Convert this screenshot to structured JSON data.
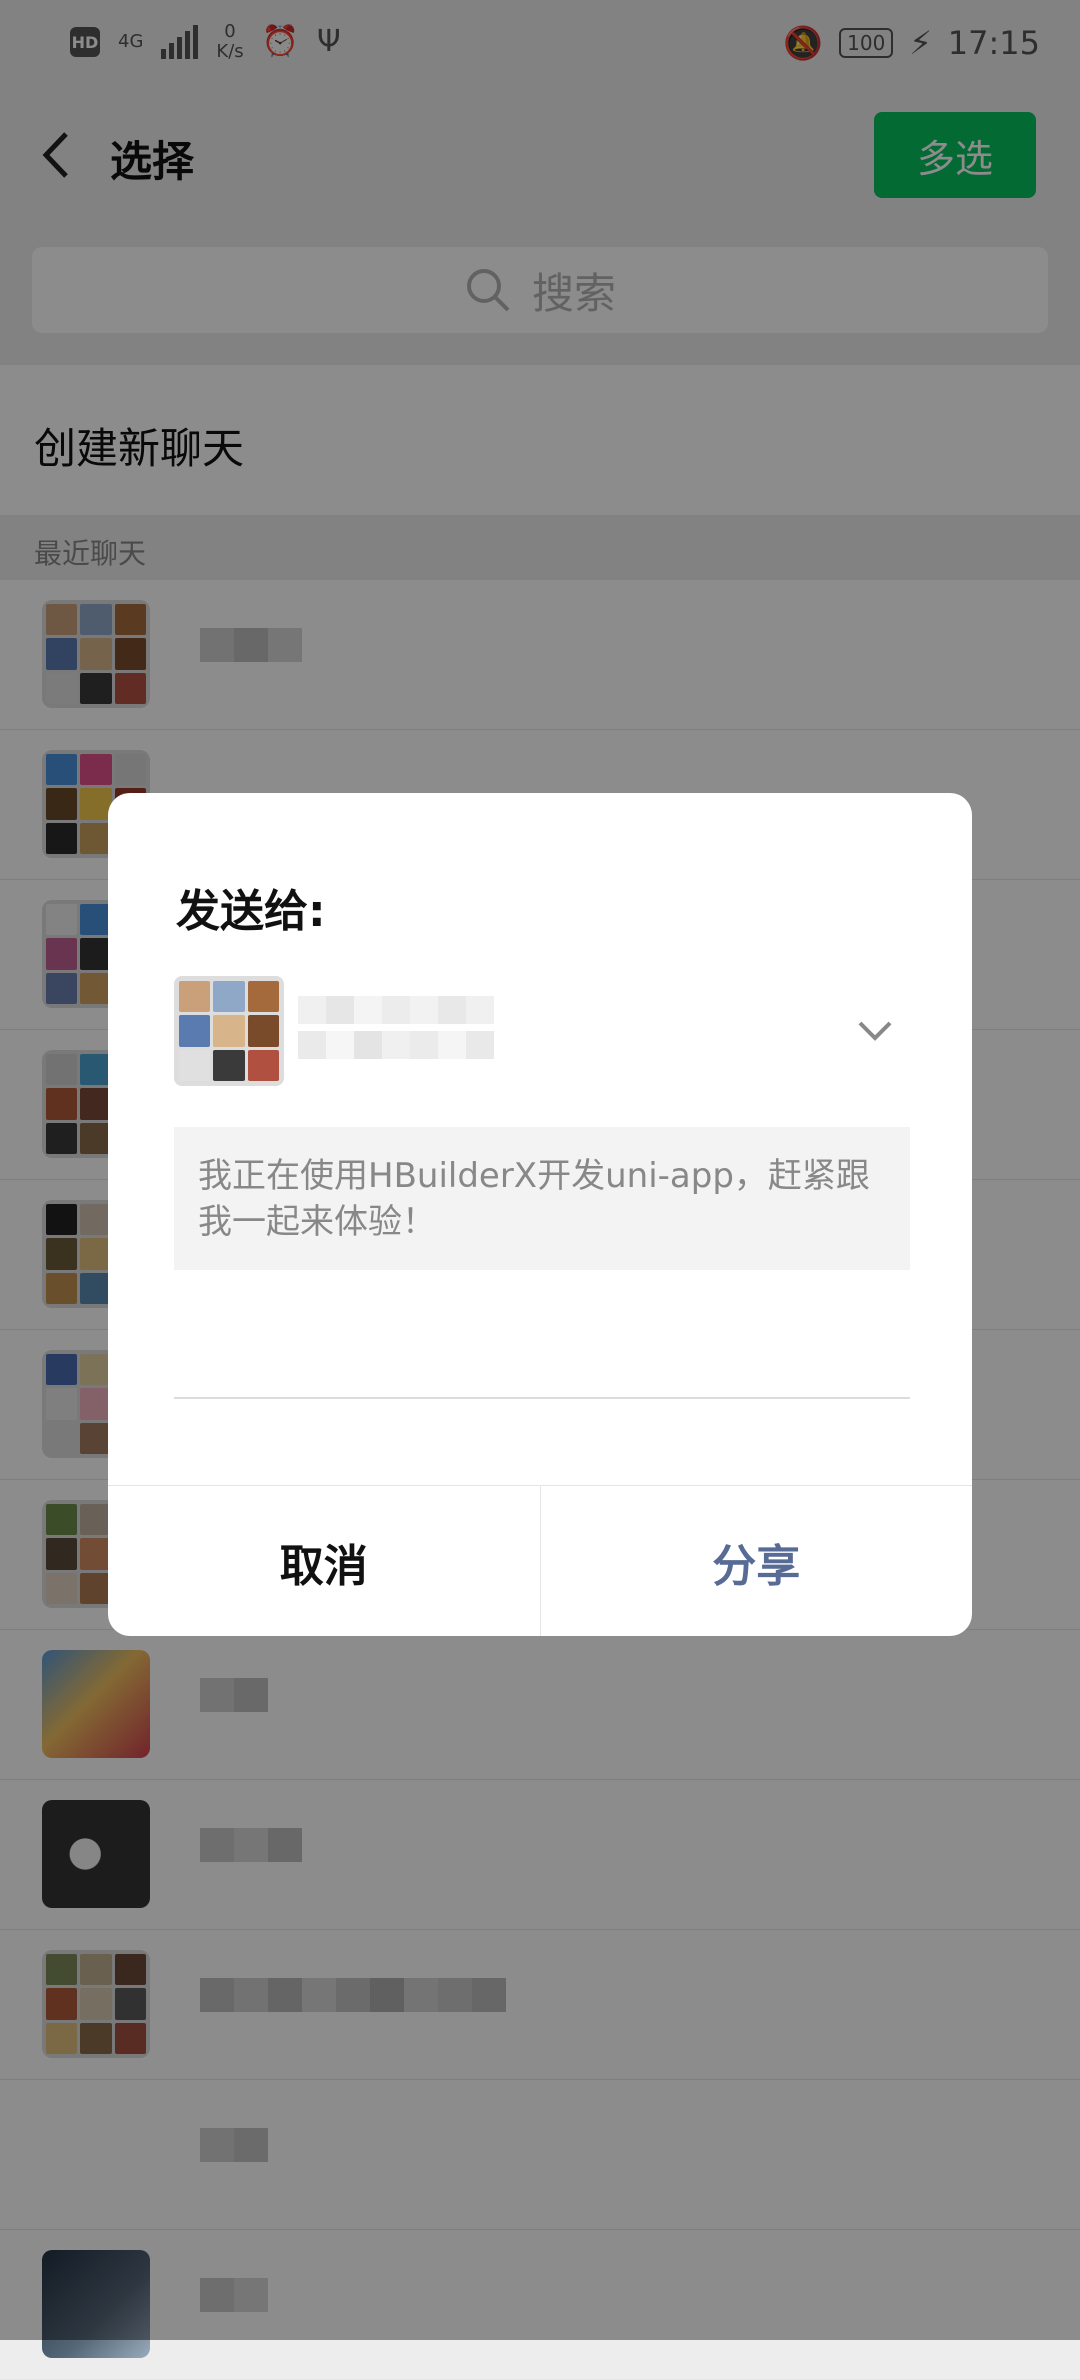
{
  "status_bar": {
    "hd": "HD",
    "network": "4G",
    "speed_value": "0",
    "speed_unit": "K/s",
    "battery": "100",
    "time": "17:15"
  },
  "header": {
    "title": "选择",
    "multi_select": "多选"
  },
  "search": {
    "label": "搜索"
  },
  "new_chat": "创建新聊天",
  "section_title": "最近聊天",
  "dialog": {
    "title": "发送给:",
    "message": "我正在使用HBuilderX开发uni-app，赶紧跟我一起来体验！",
    "cancel": "取消",
    "share": "分享"
  },
  "colors": {
    "accent_green": "#07c160",
    "share_blue": "#576b95"
  }
}
